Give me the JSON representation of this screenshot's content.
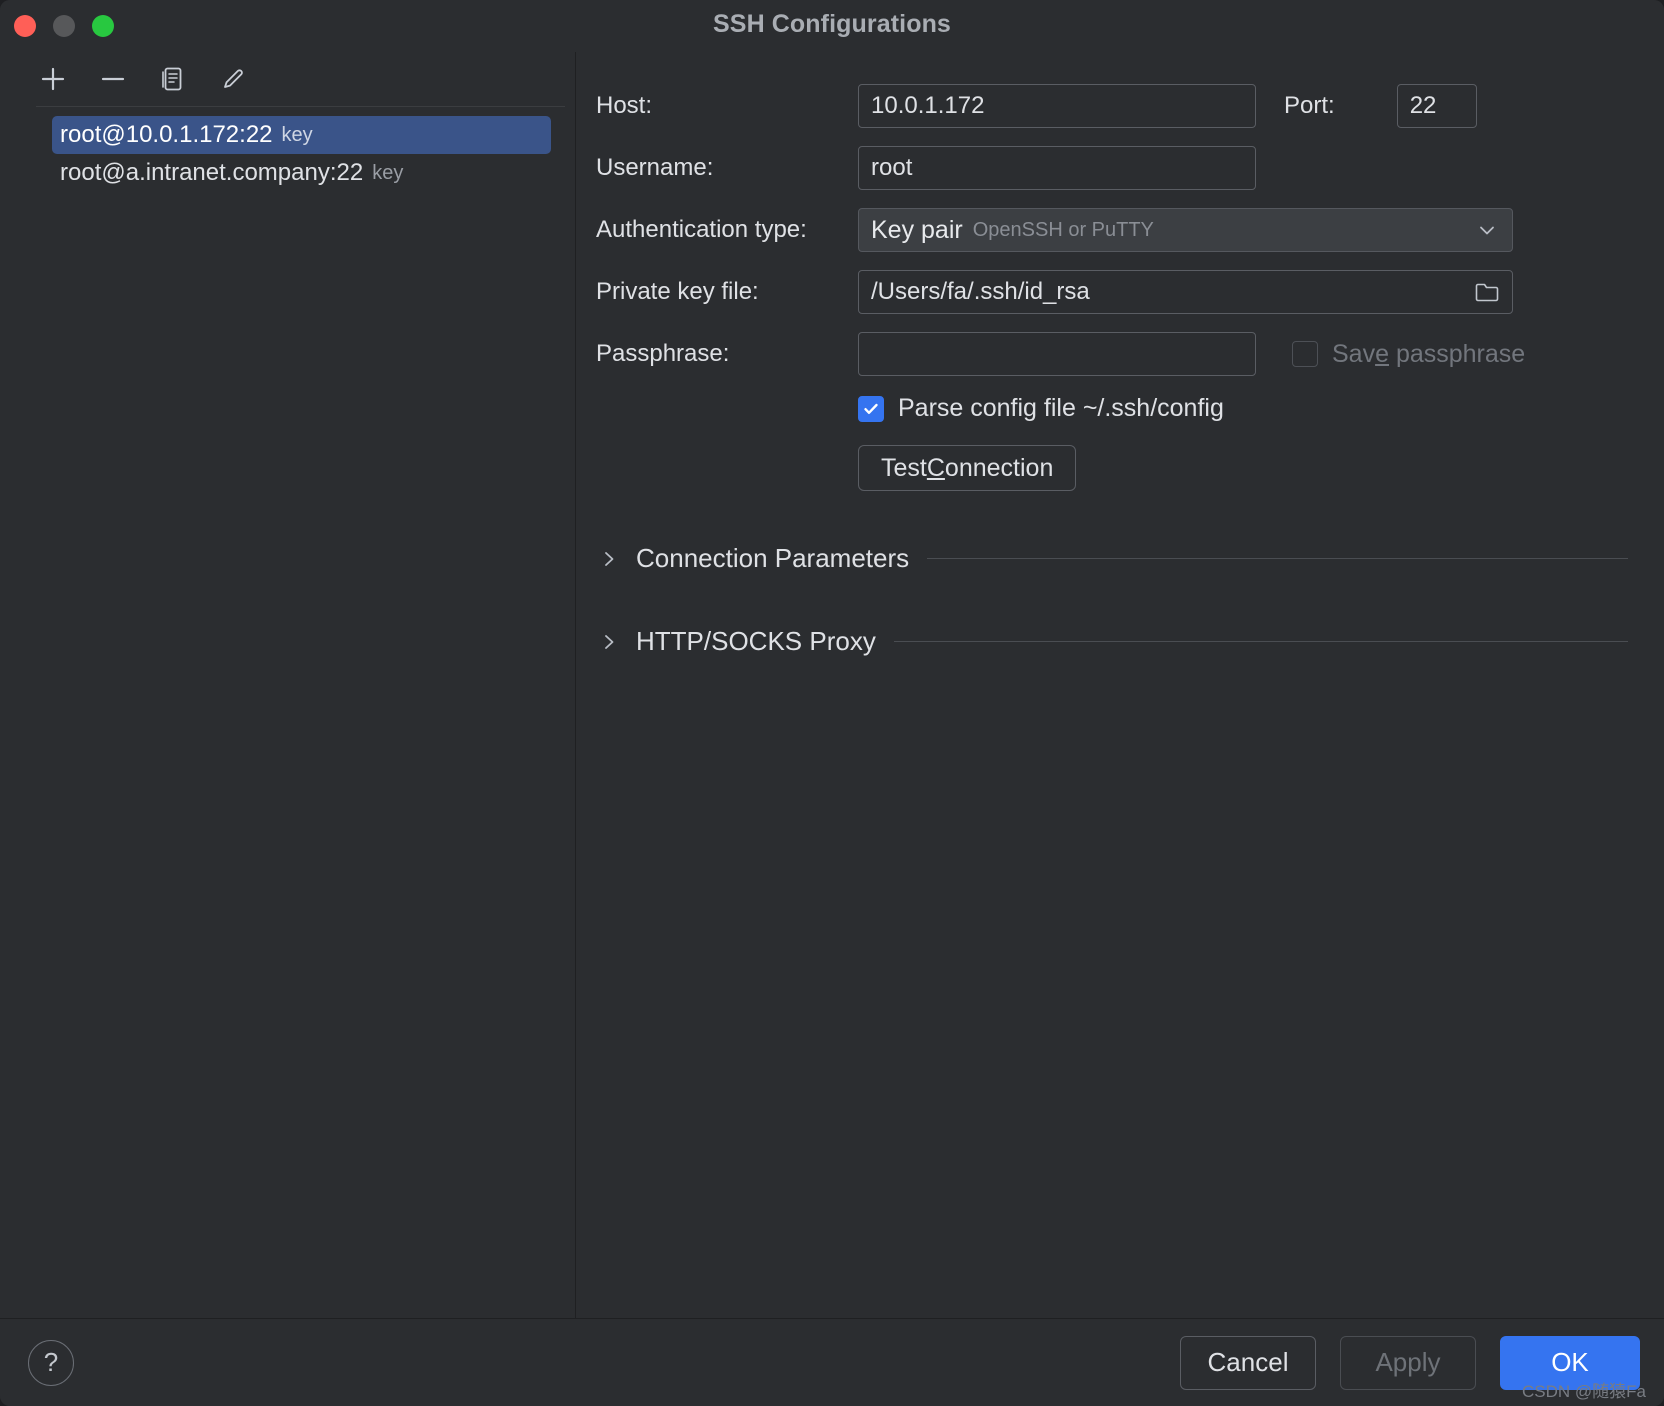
{
  "window": {
    "title": "SSH Configurations",
    "traffic_lights": [
      "close",
      "minimize",
      "maximize"
    ],
    "accent_color": "#3574f0",
    "selection_color": "#3a5489",
    "background_color": "#2b2d30"
  },
  "left_panel": {
    "toolbar": [
      {
        "name": "add",
        "icon": "plus-icon"
      },
      {
        "name": "remove",
        "icon": "minus-icon"
      },
      {
        "name": "copy",
        "icon": "copy-icon"
      },
      {
        "name": "edit",
        "icon": "pencil-icon"
      }
    ],
    "items": [
      {
        "label": "root@10.0.1.172:22",
        "suffix": "key",
        "selected": true
      },
      {
        "label": "root@a.intranet.company:22",
        "suffix": "key",
        "selected": false
      }
    ]
  },
  "form": {
    "host": {
      "label": "Host:",
      "value": "10.0.1.172"
    },
    "port": {
      "label": "Port:",
      "value": "22"
    },
    "username": {
      "label": "Username:",
      "value": "root"
    },
    "auth_type": {
      "label": "Authentication type:",
      "value": "Key pair",
      "hint": "OpenSSH or PuTTY"
    },
    "private_key": {
      "label": "Private key file:",
      "value": "/Users/fa/.ssh/id_rsa",
      "browse_icon": "folder-icon"
    },
    "passphrase": {
      "label": "Passphrase:",
      "value": "",
      "placeholder": ""
    },
    "save_passphrase": {
      "label_before": "Sav",
      "label_mnemonic": "e",
      "label_after": " passphrase",
      "checked": false,
      "enabled": false
    },
    "parse_config": {
      "label": "Parse config file ~/.ssh/config",
      "checked": true
    },
    "test_connection": {
      "label_before": "Test ",
      "label_mnemonic": "C",
      "label_after": "onnection"
    },
    "sections": [
      {
        "title": "Connection Parameters",
        "expanded": false,
        "chevron": "chevron-right-icon"
      },
      {
        "title": "HTTP/SOCKS Proxy",
        "expanded": false,
        "chevron": "chevron-right-icon"
      }
    ]
  },
  "footer": {
    "help": "?",
    "cancel": "Cancel",
    "apply": "Apply",
    "apply_enabled": false,
    "ok": "OK",
    "watermark": "CSDN @随猿Fa"
  }
}
